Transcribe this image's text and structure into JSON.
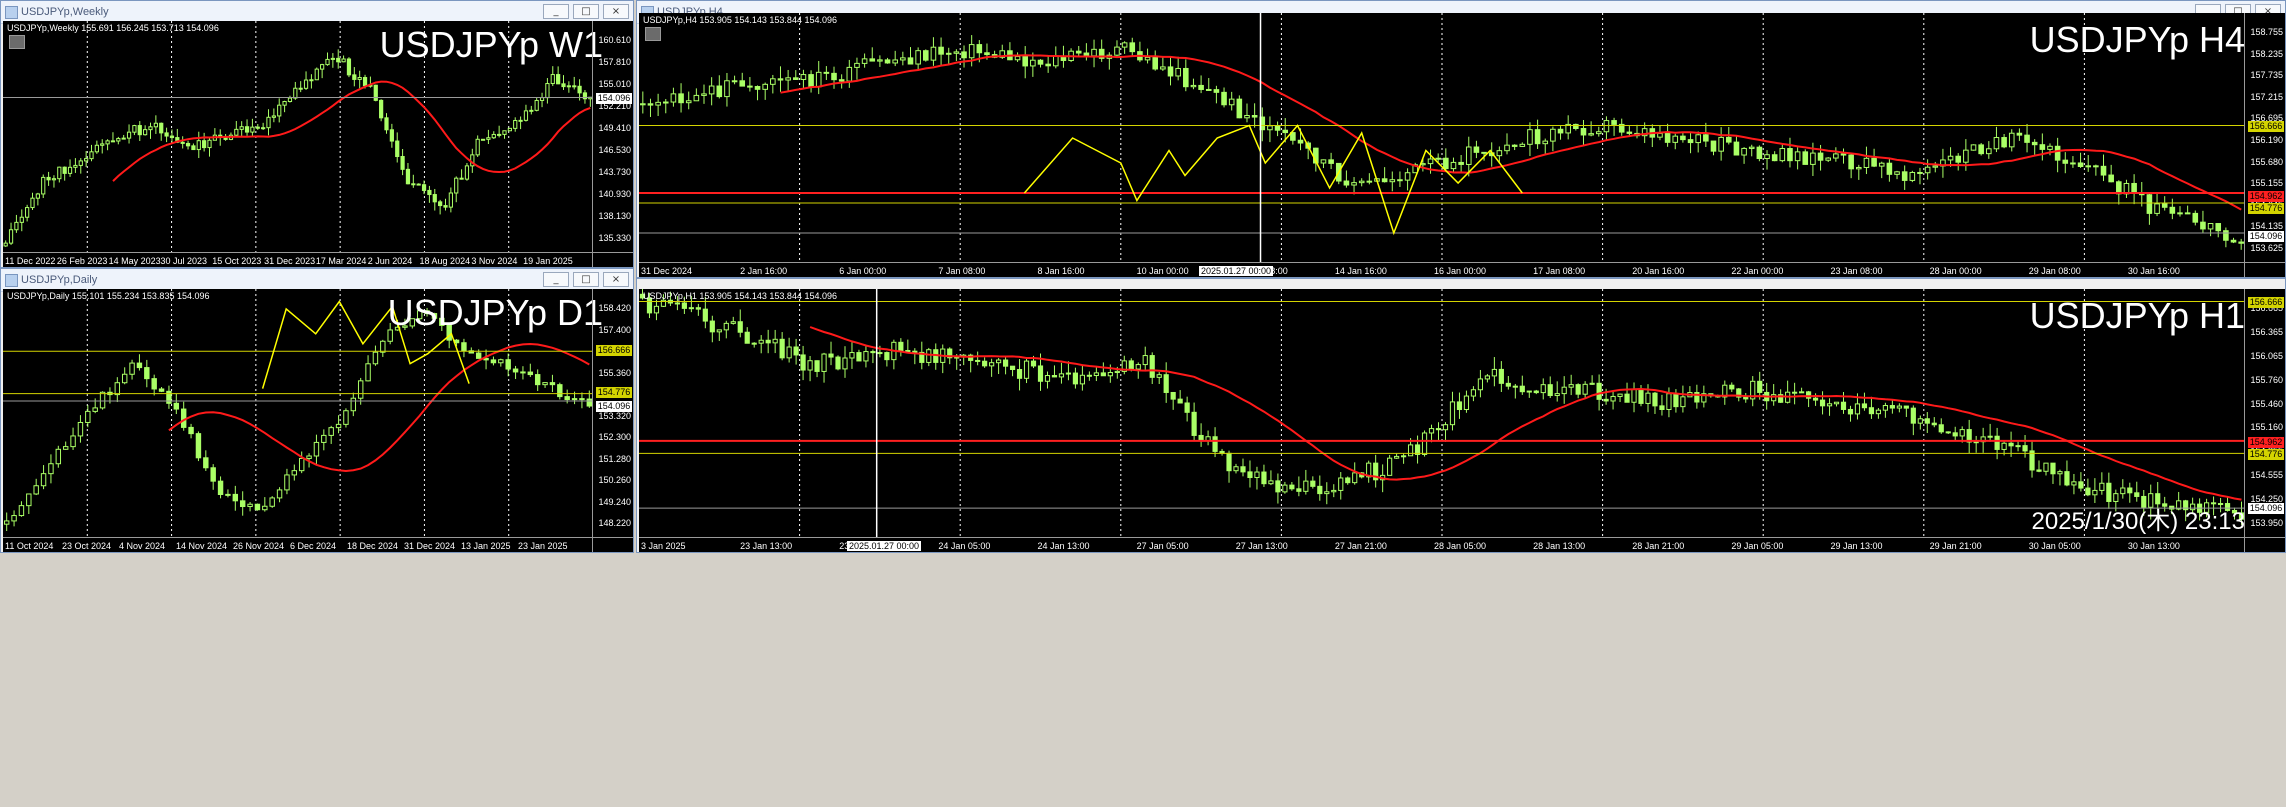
{
  "windows": {
    "w1": {
      "title": "USDJPYp,Weekly",
      "info": "USDJPYp,Weekly  155.691 156.245 153.713 154.096",
      "big_label": "USDJPYp W1",
      "price_labels": [
        "160.610",
        "157.810",
        "155.010",
        "152.210",
        "149.410",
        "146.530",
        "143.730",
        "140.930",
        "138.130",
        "135.330"
      ],
      "price_box": "154.096",
      "time_labels": [
        "11 Dec 2022",
        "26 Feb 2023",
        "14 May 2023",
        "30 Jul 2023",
        "15 Oct 2023",
        "31 Dec 2023",
        "17 Mar 2024",
        "2 Jun 2024",
        "18 Aug 2024",
        "3 Nov 2024",
        "19 Jan 2025"
      ]
    },
    "d1": {
      "title": "USDJPYp,Daily",
      "info": "USDJPYp,Daily  155.101 155.234 153.835 154.096",
      "big_label": "USDJPYp D1",
      "price_labels": [
        "158.420",
        "157.400",
        "156.380",
        "155.360",
        "154.340",
        "153.320",
        "152.300",
        "151.280",
        "150.260",
        "149.240",
        "148.220"
      ],
      "boxes": [
        "156.666",
        "154.776",
        "154.096"
      ],
      "time_labels": [
        "11 Oct 2024",
        "23 Oct 2024",
        "4 Nov 2024",
        "14 Nov 2024",
        "26 Nov 2024",
        "6 Dec 2024",
        "18 Dec 2024",
        "31 Dec 2024",
        "13 Jan 2025",
        "23 Jan 2025"
      ]
    },
    "h4": {
      "title": "USDJPYp,H4",
      "info": "USDJPYp,H4  153.905 154.143 153.844 154.096",
      "big_label": "USDJPYp H4",
      "price_labels": [
        "158.755",
        "158.235",
        "157.735",
        "157.215",
        "156.695",
        "156.190",
        "155.680",
        "155.155",
        "154.645",
        "154.135",
        "153.625"
      ],
      "boxes": [
        "156.666",
        "154.962",
        "154.776",
        "154.096"
      ],
      "time_labels": [
        "31 Dec 2024",
        "2 Jan 16:00",
        "6 Jan 00:00",
        "7 Jan 08:00",
        "8 Jan 16:00",
        "10 Jan 00:00",
        "13 Jan 08:00",
        "14 Jan 16:00",
        "16 Jan 00:00",
        "17 Jan 08:00",
        "20 Jan 16:00",
        "22 Jan 00:00",
        "23 Jan 08:00",
        "28 Jan 00:00",
        "29 Jan 08:00",
        "30 Jan 16:00"
      ],
      "cross_label": "2025.01.27 00:00"
    },
    "h1": {
      "title": "USDJPYp,H1",
      "info": "USDJPYp,H1  153.905 154.143 153.844 154.096",
      "big_label": "USDJPYp H1",
      "clock": "2025/1/30(木) 23:13",
      "price_labels": [
        "156.665",
        "156.365",
        "156.065",
        "155.760",
        "155.460",
        "155.160",
        "154.855",
        "154.555",
        "154.250",
        "153.950"
      ],
      "boxes": [
        "156.666",
        "154.962",
        "154.776",
        "154.096"
      ],
      "time_labels": [
        "3 Jan 2025",
        "23 Jan 13:00",
        "23 Jan 21:00",
        "24 Jan 05:00",
        "24 Jan 13:00",
        "27 Jan 05:00",
        "27 Jan 13:00",
        "27 Jan 21:00",
        "28 Jan 05:00",
        "28 Jan 13:00",
        "28 Jan 21:00",
        "29 Jan 05:00",
        "29 Jan 13:00",
        "29 Jan 21:00",
        "30 Jan 05:00",
        "30 Jan 13:00"
      ],
      "cross_label": "2025.01.27 00:00"
    }
  },
  "buttons": {
    "minimize": "_",
    "maximize": "□",
    "close": "×"
  },
  "colors": {
    "bg": "#000000",
    "candle": "#aaff66",
    "ma": "#ff1a1a",
    "level": "#d4d400",
    "zigzag": "#ffff00",
    "level_red": "#ff2020"
  }
}
